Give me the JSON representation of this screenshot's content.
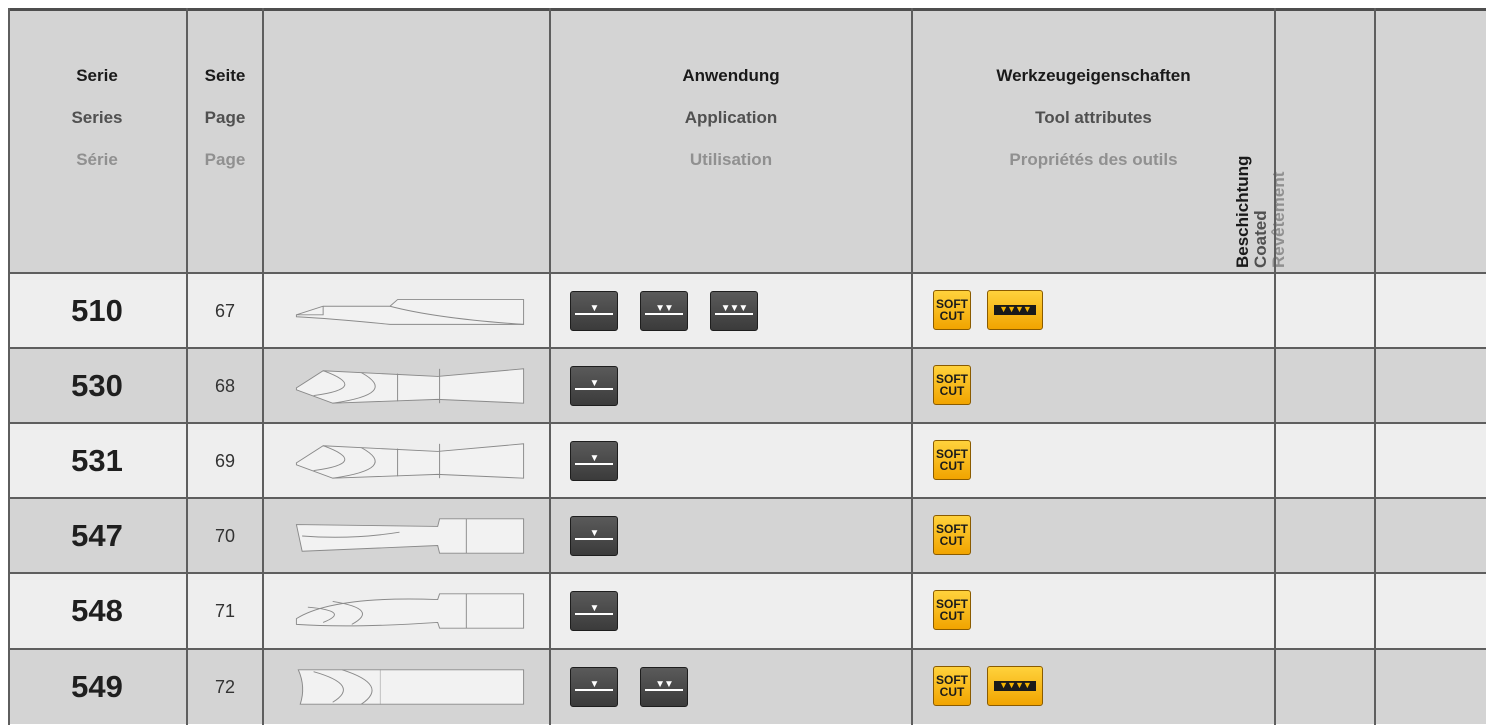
{
  "header": {
    "series": {
      "de": "Serie",
      "en": "Series",
      "fr": "Série"
    },
    "page": {
      "de": "Seite",
      "en": "Page",
      "fr": "Page"
    },
    "application": {
      "de": "Anwendung",
      "en": "Application",
      "fr": "Utilisation"
    },
    "attributes": {
      "de": "Werkzeugeigenschaften",
      "en": "Tool attributes",
      "fr": "Propriétés des outils"
    },
    "coating": {
      "de": "Beschichtung",
      "en": "Coated",
      "fr": "Revêtement"
    }
  },
  "icon_labels": {
    "soft_cut_line1": "SOFT",
    "soft_cut_line2": "CUT"
  },
  "colors": {
    "header_bg": "#d4d4d4",
    "row_light": "#eeeeee",
    "row_dark": "#d4d4d4",
    "grid_line": "#5e5e5e",
    "soft_cut_yellow": "#f5b300"
  },
  "rows": [
    {
      "series": "510",
      "page": "67",
      "tool_icon": "straight-flute-router-icon",
      "application": [
        "roughing-icon-1",
        "roughing-icon-2",
        "roughing-icon-3"
      ],
      "attributes": [
        "soft-cut-icon",
        "serrated-edge-icon"
      ]
    },
    {
      "series": "530",
      "page": "68",
      "tool_icon": "single-flute-spiral-router-icon",
      "application": [
        "roughing-icon-1"
      ],
      "attributes": [
        "soft-cut-icon"
      ]
    },
    {
      "series": "531",
      "page": "69",
      "tool_icon": "single-flute-spiral-router-icon",
      "application": [
        "roughing-icon-1"
      ],
      "attributes": [
        "soft-cut-icon"
      ]
    },
    {
      "series": "547",
      "page": "70",
      "tool_icon": "tapered-router-icon",
      "application": [
        "roughing-icon-1"
      ],
      "attributes": [
        "soft-cut-icon"
      ]
    },
    {
      "series": "548",
      "page": "71",
      "tool_icon": "tapered-spiral-router-icon",
      "application": [
        "roughing-icon-1"
      ],
      "attributes": [
        "soft-cut-icon"
      ]
    },
    {
      "series": "549",
      "page": "72",
      "tool_icon": "short-spiral-router-icon",
      "application": [
        "roughing-icon-1",
        "roughing-icon-2"
      ],
      "attributes": [
        "soft-cut-icon",
        "serrated-edge-icon"
      ]
    }
  ]
}
